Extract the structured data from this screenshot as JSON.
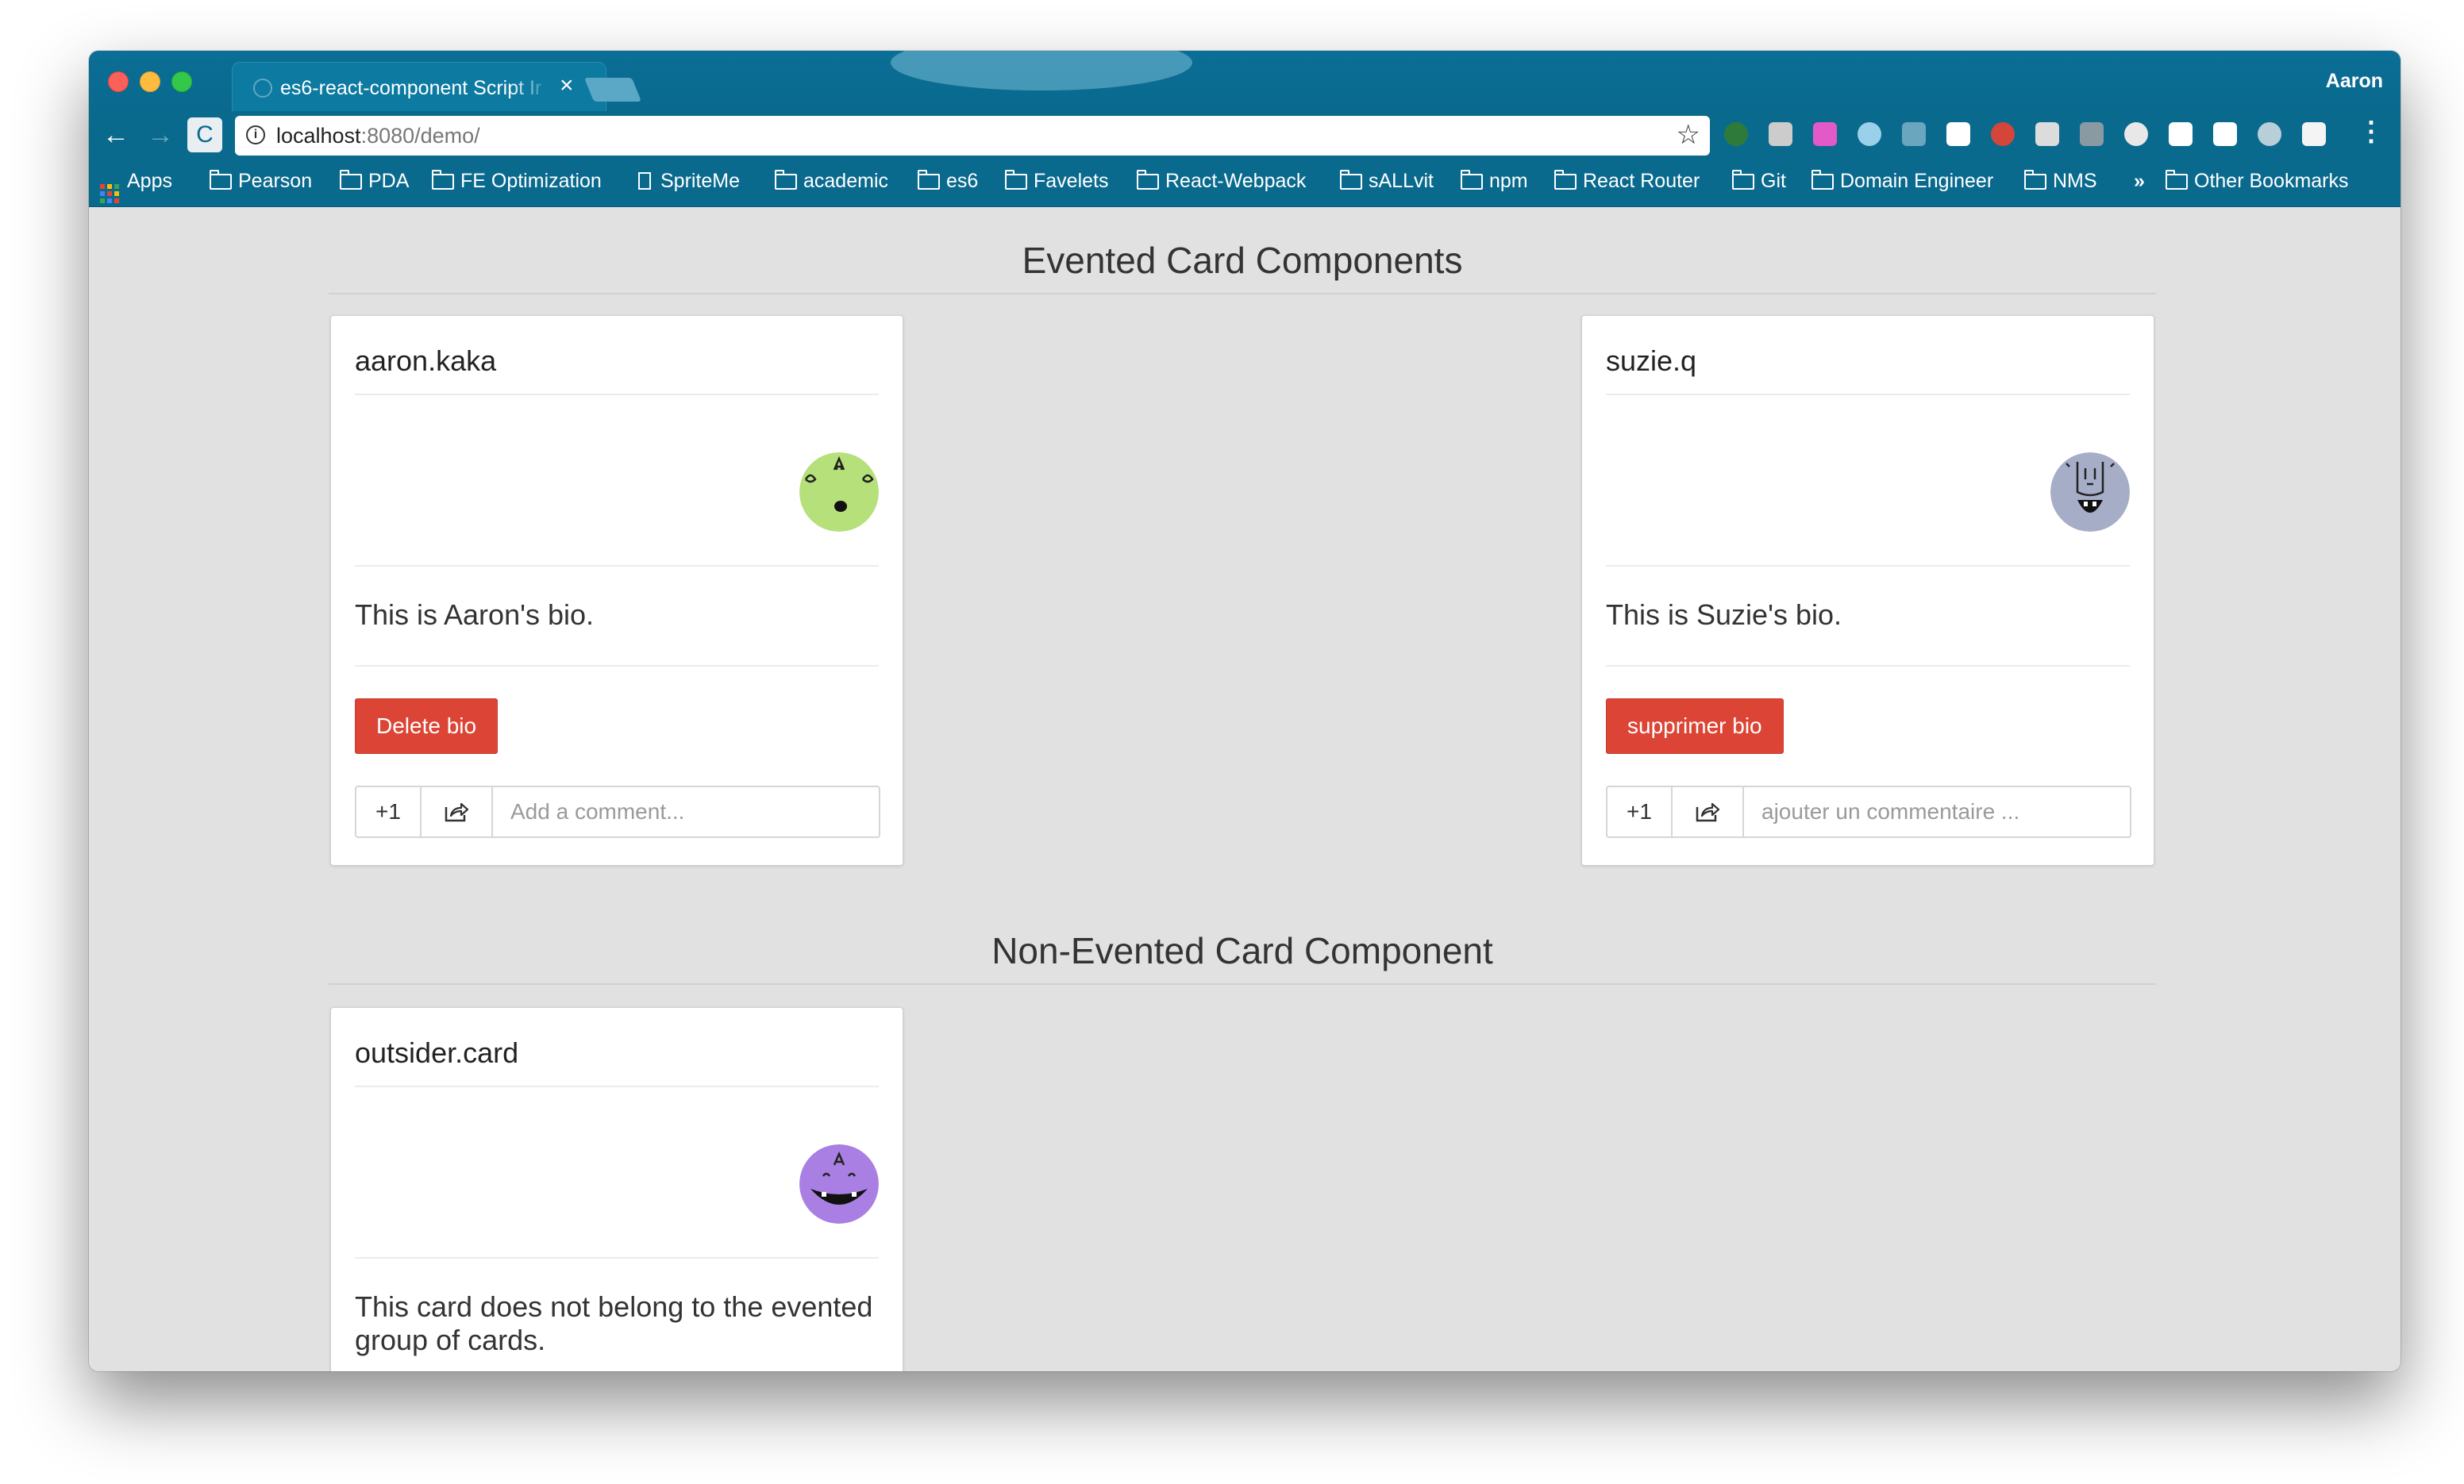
{
  "browser": {
    "tab_title": "es6-react-component Script Ir",
    "tab_close": "×",
    "profile_name": "Aaron",
    "url_host": "localhost",
    "url_path": ":8080/demo/",
    "nav": {
      "back": "←",
      "forward": "→",
      "reload": "C"
    },
    "info_icon": "i",
    "star": "☆",
    "menu": "⋮",
    "extensions": [
      "hat-ext-icon",
      "pen-ext-icon",
      "color-wheel-ext-icon",
      "snowflake-ext-icon",
      "circle-ext-icon",
      "white-circle-ext-icon",
      "red-ext-icon",
      "grey-ext-icon",
      "json-ext-icon",
      "font-ext-icon",
      "target-ext-icon",
      "chat-ext-icon",
      "skype-ext-icon",
      "square-ext-icon"
    ],
    "extension_colors": [
      "#2d7a3a",
      "#cccccc",
      "#e25ac8",
      "#9ad0ea",
      "#6aa6bd",
      "#ffffff",
      "#d6453a",
      "#dcdcdc",
      "#8a9aa3",
      "#e8e8e8",
      "#ffffff",
      "#ffffff",
      "#b8cfd9",
      "#f4f4f4"
    ]
  },
  "bookmarks": {
    "apps": "Apps",
    "items": [
      "Pearson",
      "PDA",
      "FE Optimization",
      "SpriteMe",
      "academic",
      "es6",
      "Favelets",
      "React-Webpack",
      "sALLvit",
      "npm",
      "React Router",
      "Git",
      "Domain Engineer",
      "NMS"
    ],
    "overflow": "»",
    "other": "Other Bookmarks"
  },
  "page": {
    "evented_heading": "Evented Card Components",
    "non_evented_heading": "Non-Evented Card Component"
  },
  "cards": [
    {
      "username": "aaron.kaka",
      "bio": "This is Aaron's bio.",
      "delete_label": "Delete bio",
      "plus_label": "+1",
      "comment_placeholder": "Add a comment...",
      "avatar_color": "#b5e07a"
    },
    {
      "username": "suzie.q",
      "bio": "This is Suzie's bio.",
      "delete_label": "supprimer bio",
      "plus_label": "+1",
      "comment_placeholder": "ajouter un commentaire ...",
      "avatar_color": "#a6aec7"
    },
    {
      "username": "outsider.card",
      "bio": "This card does not belong to the evented group of cards.",
      "avatar_color": "#a97fe3"
    }
  ]
}
